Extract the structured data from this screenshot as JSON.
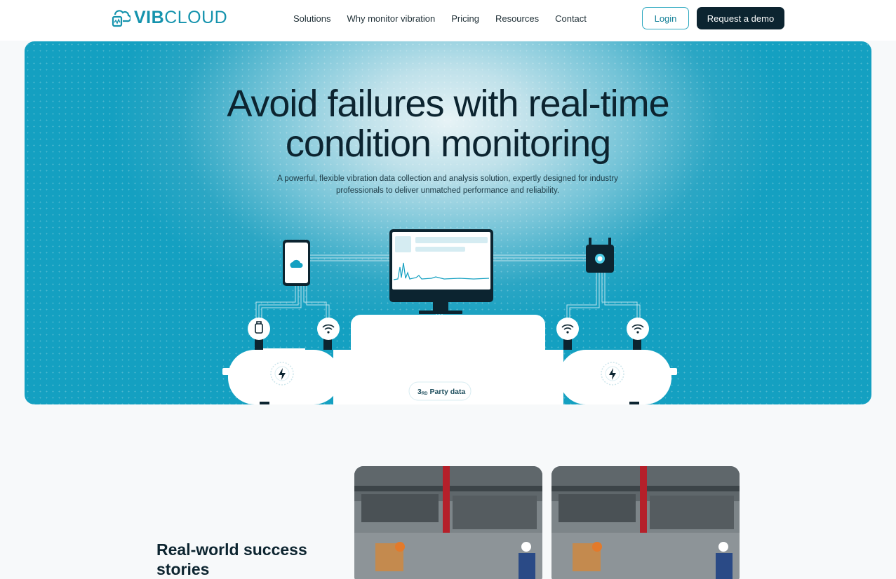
{
  "brand": {
    "name_bold": "VIB",
    "name_light": "CLOUD",
    "logo_icon": "cloud-vibration-logo-icon",
    "color": "#1593ad"
  },
  "nav": {
    "links": [
      "Solutions",
      "Why monitor vibration",
      "Pricing",
      "Resources",
      "Contact"
    ],
    "login_label": "Login",
    "demo_label": "Request a demo"
  },
  "hero": {
    "title_line1": "Avoid failures with real-time",
    "title_line2": "condition monitoring",
    "subtitle": "A powerful, flexible vibration data collection and analysis solution, expertly designed for industry professionals to deliver unmatched performance and reliability.",
    "illustration": {
      "third_party_prefix": "3",
      "third_party_sup": "RD",
      "third_party_label": "Party data",
      "icons": [
        "phone-cloud-icon",
        "monitor-chart-icon",
        "gateway-device-icon",
        "sensor-icon",
        "wifi-icon",
        "lightning-icon"
      ]
    },
    "colors": {
      "accent": "#14a0c1",
      "dark": "#0c2430"
    }
  },
  "success": {
    "title": "Real-world success stories",
    "cards": [
      {
        "image": "factory-workers-photo"
      },
      {
        "image": "factory-workers-photo"
      }
    ]
  }
}
